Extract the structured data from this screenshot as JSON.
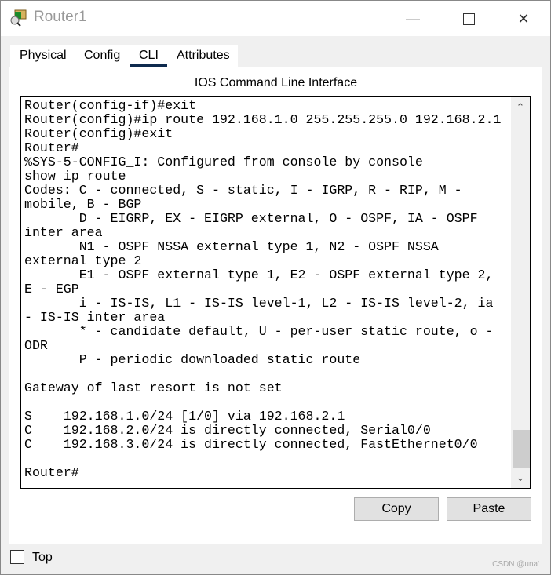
{
  "window": {
    "title": "Router1",
    "icon": "router-app-icon"
  },
  "tabs": [
    {
      "label": "Physical"
    },
    {
      "label": "Config"
    },
    {
      "label": "CLI",
      "active": true
    },
    {
      "label": "Attributes"
    }
  ],
  "cli": {
    "heading": "IOS Command Line Interface",
    "lines": [
      "Router(config-if)#exit",
      "Router(config)#ip route 192.168.1.0 255.255.255.0 192.168.2.1",
      "Router(config)#exit",
      "Router#",
      "%SYS-5-CONFIG_I: Configured from console by console",
      "show ip route",
      "Codes: C - connected, S - static, I - IGRP, R - RIP, M -",
      "mobile, B - BGP",
      "       D - EIGRP, EX - EIGRP external, O - OSPF, IA - OSPF",
      "inter area",
      "       N1 - OSPF NSSA external type 1, N2 - OSPF NSSA",
      "external type 2",
      "       E1 - OSPF external type 1, E2 - OSPF external type 2,",
      "E - EGP",
      "       i - IS-IS, L1 - IS-IS level-1, L2 - IS-IS level-2, ia",
      "- IS-IS inter area",
      "       * - candidate default, U - per-user static route, o -",
      "ODR",
      "       P - periodic downloaded static route",
      "",
      "Gateway of last resort is not set",
      "",
      "S    192.168.1.0/24 [1/0] via 192.168.2.1",
      "C    192.168.2.0/24 is directly connected, Serial0/0",
      "C    192.168.3.0/24 is directly connected, FastEthernet0/0",
      "",
      "Router#"
    ],
    "copy_label": "Copy",
    "paste_label": "Paste"
  },
  "footer": {
    "top_label": "Top",
    "top_checked": false,
    "watermark": "CSDN @una'"
  }
}
